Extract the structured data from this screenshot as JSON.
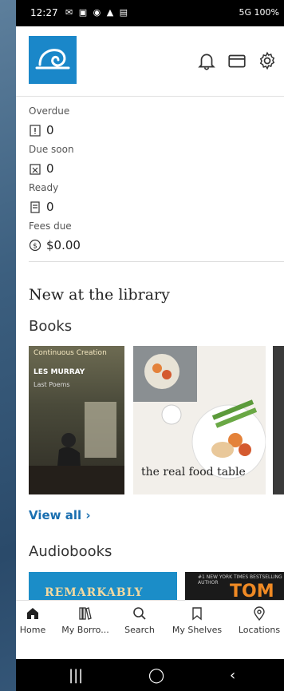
{
  "status": {
    "time": "12:27",
    "notifications": "✉ ▣ ◉ ▲ ▤",
    "right": "5G  100%"
  },
  "stats": [
    {
      "label": "Overdue",
      "value": "0"
    },
    {
      "label": "Due soon",
      "value": "0"
    },
    {
      "label": "Ready",
      "value": "0"
    },
    {
      "label": "Fees due",
      "value": "$0.00"
    }
  ],
  "section_title": "New at the library",
  "books_title": "Books",
  "book1": {
    "title": "Continuous Creation",
    "author": "LES MURRAY",
    "subtitle": "Last Poems"
  },
  "book2": {
    "title": "the real food table"
  },
  "view_all": "View all ›",
  "audiobooks_title": "Audiobooks",
  "audio1": {
    "title": "REMARKABLY BRIGHT"
  },
  "audio2": {
    "title": "TOM CLANCY",
    "tagline": "#1 NEW YORK TIMES BESTSELLING AUTHOR"
  },
  "nav": {
    "home": "Home",
    "borrowing": "My Borro...",
    "search": "Search",
    "shelves": "My Shelves",
    "locations": "Locations"
  },
  "colors": {
    "accent": "#1a87c9",
    "link": "#1a6fb0"
  }
}
